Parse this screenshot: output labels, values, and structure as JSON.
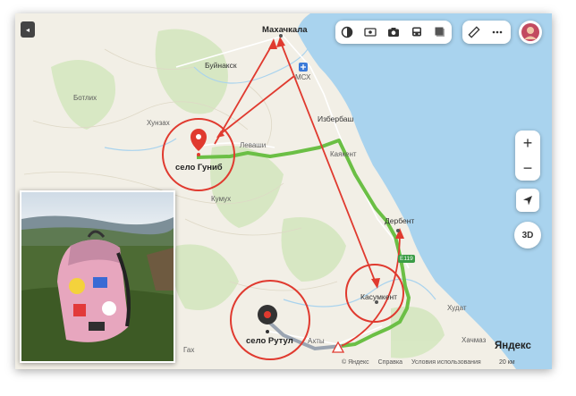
{
  "map": {
    "places": {
      "makhachkala": "Махачкала",
      "buynaksk": "Буйнакск",
      "mcx": "МСХ",
      "botlikh": "Ботлих",
      "khunzakh": "Хунзах",
      "izberbash": "Избербаш",
      "levashi": "Леваши",
      "kayakent": "Каякент",
      "kumukh": "Кумух",
      "derbent": "Дербент",
      "kasumkent": "Касумкент",
      "khudat": "Худат",
      "akhty": "Ахты",
      "khachmaz": "Хачмаз",
      "gakh": "Гах"
    },
    "highlighted": {
      "gunib": "село Гуниб",
      "rutul": "село Рутул"
    },
    "highway": "E119",
    "logo": "Яндекс",
    "copyright": [
      "© Яндекс",
      "Справка",
      "Условия использования"
    ],
    "scale": "20 км",
    "view_3d": "3D",
    "zoom_in": "+",
    "zoom_out": "−",
    "colors": {
      "route": "#6bbf45",
      "arrows": "#e03a2f",
      "sea": "#a9d3ee",
      "land": "#f2efe6"
    }
  },
  "toolbar": {
    "icons": [
      "layers-icon",
      "panorama-icon",
      "camera-icon",
      "transport-icon",
      "mapset-icon"
    ],
    "tools": [
      "ruler-icon",
      "more-icon"
    ]
  }
}
